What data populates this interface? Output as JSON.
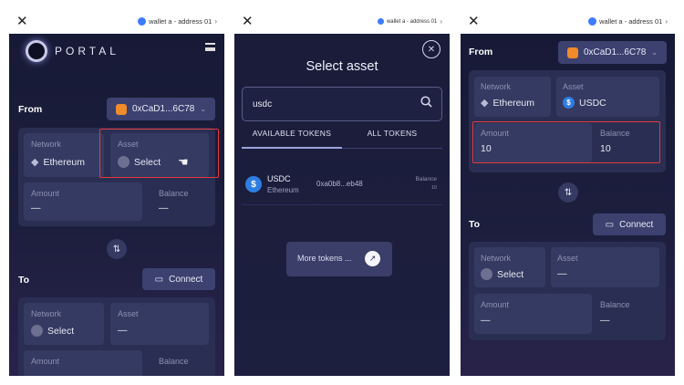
{
  "panel1": {
    "topbar": {
      "wallet": "wallet a - address 01"
    },
    "logo": "PORTAL",
    "from": {
      "title": "From",
      "address": "0xCaD1...6C78",
      "network_label": "Network",
      "network_value": "Ethereum",
      "asset_label": "Asset",
      "asset_value": "Select",
      "amount_label": "Amount",
      "amount_value": "—",
      "balance_label": "Balance",
      "balance_value": "—"
    },
    "to": {
      "title": "To",
      "connect_label": "Connect",
      "network_label": "Network",
      "network_value": "Select",
      "asset_label": "Asset",
      "asset_value": "—",
      "amount_label": "Amount",
      "balance_label": "Balance"
    }
  },
  "panel2": {
    "topbar": {
      "wallet": "wallet a - address 01"
    },
    "title": "Select asset",
    "search_value": "usdc",
    "tabs": [
      "AVAILABLE TOKENS",
      "ALL TOKENS"
    ],
    "token": {
      "symbol": "USDC",
      "network": "Ethereum",
      "address": "0xa0b8...eb48",
      "balance_label": "Balance",
      "balance_value": "10"
    },
    "more_tokens": "More tokens ..."
  },
  "panel3": {
    "topbar": {
      "wallet": "wallet a - address 01"
    },
    "from": {
      "title": "From",
      "address": "0xCaD1...6C78",
      "network_label": "Network",
      "network_value": "Ethereum",
      "asset_label": "Asset",
      "asset_value": "USDC",
      "amount_label": "Amount",
      "amount_value": "10",
      "balance_label": "Balance",
      "balance_value": "10"
    },
    "to": {
      "title": "To",
      "connect_label": "Connect",
      "network_label": "Network",
      "network_value": "Select",
      "asset_label": "Asset",
      "asset_value": "—",
      "amount_label": "Amount",
      "amount_value": "—",
      "balance_label": "Balance",
      "balance_value": "—"
    }
  }
}
